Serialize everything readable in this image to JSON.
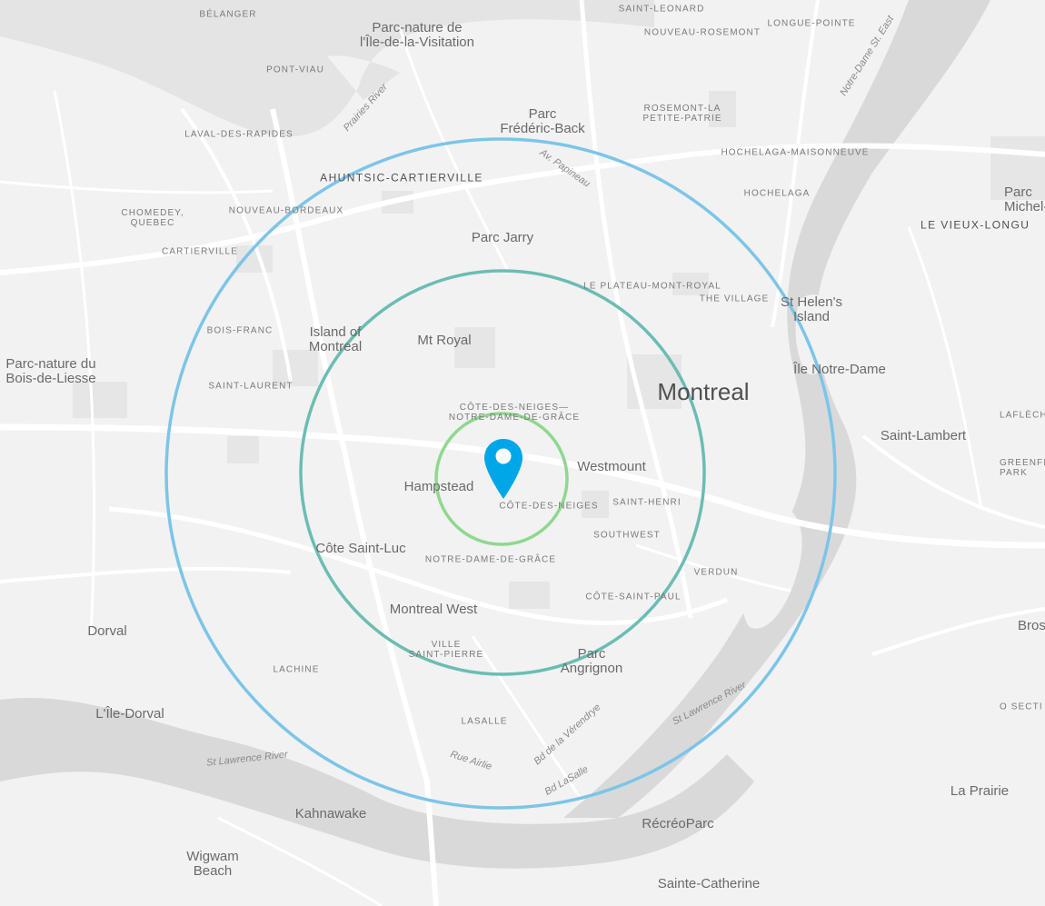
{
  "map": {
    "colors": {
      "land": "#f2f2f2",
      "water": "#d9d9d9",
      "road": "#ffffff",
      "block": "#e6e6e6",
      "ring_outer": "#7cc5e8",
      "ring_middle": "#6bbdb3",
      "ring_inner": "#8fd88f",
      "pin": "#00a7e8"
    },
    "labels": {
      "belanger": "BÉLANGER",
      "saint_leonard": "SAINT-LEONARD",
      "longue_pointe": "LONGUE-POINTE",
      "nouveau_rosemont": "NOUVEAU-ROSEMONT",
      "parc_visitation": "Parc-nature de\nl'Île-de-la-Visitation",
      "pont_viau": "PONT-VIAU",
      "notre_dame_st_east": "Notre-Dame St. East",
      "prairies_river": "Prairies River",
      "laval_des_rapides": "LAVAL-DES-RAPIDES",
      "parc_frederic_back": "Parc\nFrédéric-Back",
      "rosemont": "ROSEMONT-LA\nPETITE-PATRIE",
      "hochelaga_maisonneuve": "HOCHELAGA-MAISONNEUVE",
      "av_papineau": "Av. Papineau",
      "ahuntsic": "AHUNTSIC-CARTIERVILLE",
      "hochelaga": "HOCHELAGA",
      "parc_michel_chartrand": "Parc\nMichel-Chart",
      "vieux_longueuil": "LE VIEUX-LONGU",
      "chomedey": "CHOMEDEY,\nQUEBEC",
      "nouveau_bordeaux": "NOUVEAU-BORDEAUX",
      "parc_jarry": "Parc Jarry",
      "cartierville": "CARTIERVILLE",
      "plateau": "LE PLATEAU-MONT-ROYAL",
      "the_village": "THE VILLAGE",
      "st_helens": "St Helen's\nIsland",
      "bois_franc": "BOIS-FRANC",
      "island_of_montreal": "Island of\nMontreal",
      "mt_royal": "Mt Royal",
      "parc_bois_liesse": "Parc-nature du\nBois-de-Liesse",
      "ile_notre_dame": "Île Notre-Dame",
      "saint_laurent": "SAINT-LAURENT",
      "montreal": "Montreal",
      "cdn_ndg": "CÔTE-DES-NEIGES—\nNOTRE-DAME-DE-GRÂCE",
      "laflech": "LAFLÈCH",
      "saint_lambert": "Saint-Lambert",
      "westmount": "Westmount",
      "greenfield_park": "GREENFI\nPARK",
      "hampstead": "Hampstead",
      "cote_des_neiges": "CÔTE-DES-NEIGES",
      "saint_henri": "SAINT-HENRI",
      "southwest": "SOUTHWEST",
      "cote_saint_luc": "Côte Saint-Luc",
      "notre_dame_de_grace": "NOTRE-DAME-DE-GRÂCE",
      "verdun": "VERDUN",
      "cote_saint_paul": "CÔTE-SAINT-PAUL",
      "montreal_west": "Montreal West",
      "dorval": "Dorval",
      "brossard": "Bros",
      "ville_saint_pierre": "VILLE\nSAINT-PIERRE",
      "parc_angrignon": "Parc\nAngrignon",
      "lachine": "LACHINE",
      "st_lawrence_east": "St Lawrence River",
      "l_ile_dorval": "L'Île-Dorval",
      "lasalle": "LASALLE",
      "secteur": "O SECTI",
      "bd_verendrye": "Bd de la Vérendrye",
      "st_lawrence_west": "St Lawrence River",
      "rue_airlie": "Rue Airlie",
      "bd_lasalle": "Bd LaSalle",
      "la_prairie": "La Prairie",
      "kahnawake": "Kahnawake",
      "recreoparc": "RécréoParc",
      "wigwam_beach": "Wigwam\nBeach",
      "sainte_catherine": "Sainte-Catherine"
    }
  }
}
